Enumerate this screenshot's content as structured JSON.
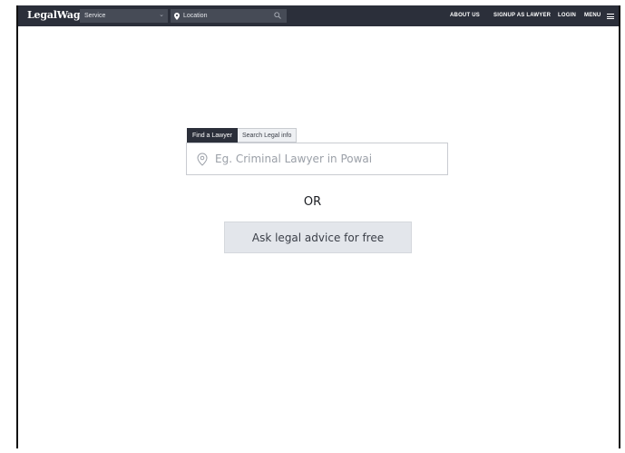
{
  "header": {
    "logo": "LegalWagon",
    "service_select": "Service",
    "location_input": "Location",
    "nav": {
      "about": "ABOUT US",
      "signup": "SIGNUP AS LAWYER",
      "login": "LOGIN",
      "menu": "MENU"
    }
  },
  "search": {
    "tabs": [
      {
        "label": "Find a Lawyer",
        "active": true
      },
      {
        "label": "Search Legal info",
        "active": false
      }
    ],
    "placeholder": "Eg. Criminal Lawyer in Powai"
  },
  "or_text": "OR",
  "ask_button": "Ask legal advice for free",
  "colors": {
    "header_bg": "#2b2f3a",
    "input_bg": "#464b56",
    "button_bg": "#e3e6eb"
  }
}
